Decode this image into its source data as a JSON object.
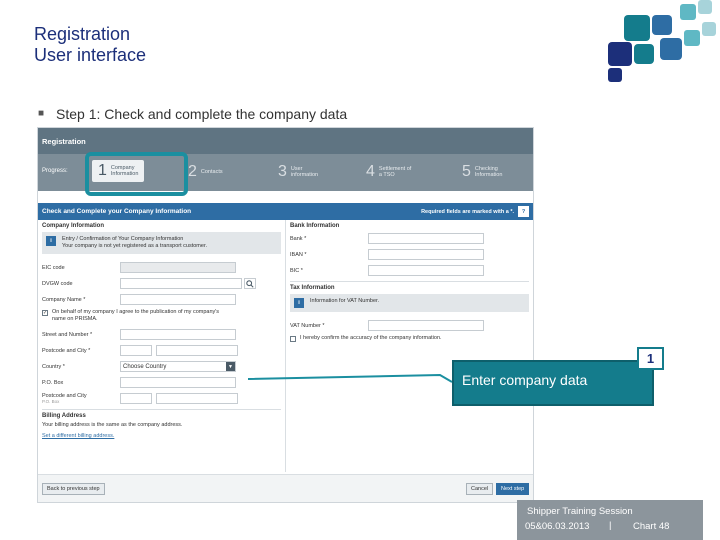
{
  "slide": {
    "title": "Registration",
    "subtitle": "User interface",
    "bullet": "Step 1: Check and complete the company data"
  },
  "app": {
    "header": "Registration",
    "progress_label": "Progress:",
    "steps": [
      {
        "num": "1",
        "label1": "Company",
        "label2": "Information"
      },
      {
        "num": "2",
        "label1": "Contacts",
        "label2": ""
      },
      {
        "num": "3",
        "label1": "User",
        "label2": "information"
      },
      {
        "num": "4",
        "label1": "Settlement of",
        "label2": "a TSO"
      },
      {
        "num": "5",
        "label1": "Checking",
        "label2": "Information"
      }
    ],
    "form_title": "Check and Complete your Company Information",
    "required_note": "Required fields are marked with a *.",
    "help": "?",
    "left": {
      "section": "Company Information",
      "info_line1": "Entry / Confirmation of Your Company Information",
      "info_line2": "Your company is not yet registered as a transport customer.",
      "fields": [
        {
          "label": "EIC code"
        },
        {
          "label": "DVGW code"
        },
        {
          "label": "Company Name *"
        }
      ],
      "consent_line1": "On behalf of my company I agree to the publication of my company's",
      "consent_line2": "name on PRISMA.",
      "fields2": [
        {
          "label": "Street and Number *"
        },
        {
          "label": "Postcode and City *"
        }
      ],
      "country_label": "Country *",
      "country_value": "Choose Country",
      "po_box": "P.O. Box",
      "po_city": "Postcode and City",
      "po_city_hint": "P.O. Box",
      "billing_title": "Billing Address",
      "billing_text": "Your billing address is the same as the company address.",
      "billing_link": "Set a different billing address."
    },
    "right": {
      "bank_title": "Bank Information",
      "bank_fields": [
        "Bank *",
        "IBAN *",
        "BIC *"
      ],
      "tax_title": "Tax Information",
      "tax_info": "Information for VAT Number.",
      "vat_label": "VAT Number *",
      "confirm_text": "I hereby confirm the accuracy of the company information."
    },
    "back_button": "Back to previous step",
    "cancel_button": "Cancel",
    "next_button": "Next step"
  },
  "callout": {
    "number": "1",
    "text": "Enter company data"
  },
  "footer": {
    "session": "Shipper Training Session",
    "dates": "05&06.03.2013",
    "separator": "|",
    "chart": "Chart 48"
  },
  "colors": {
    "title": "#1c2f7a",
    "accent": "#147c8c",
    "app_blue": "#2e6da4"
  }
}
